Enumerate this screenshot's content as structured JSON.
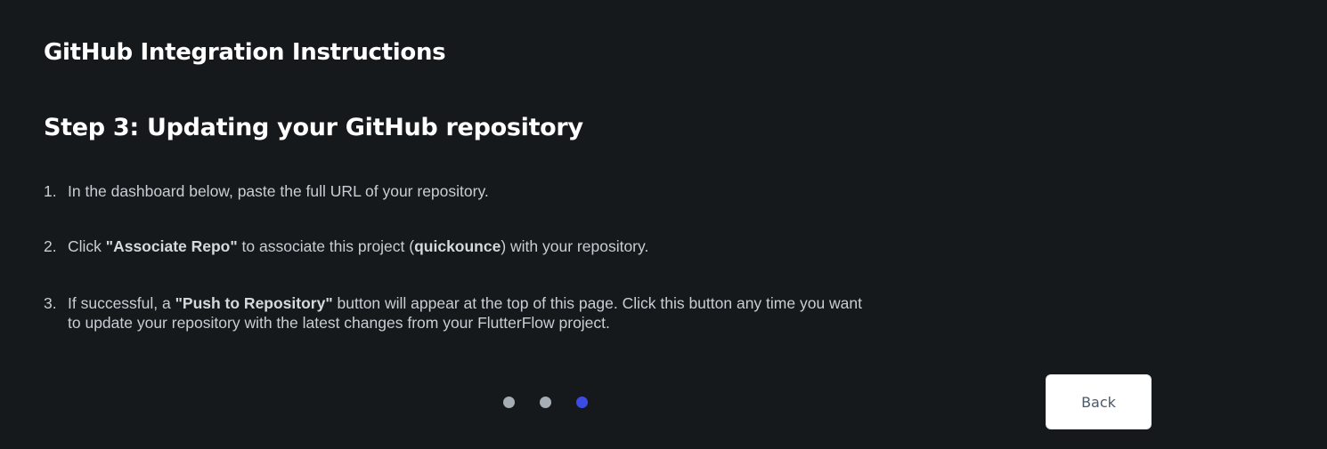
{
  "dialog": {
    "title": "GitHub Integration Instructions",
    "step_title": "Step 3: Updating your GitHub repository",
    "instructions": [
      {
        "number": "1.",
        "text": "In the dashboard below, paste the full URL of your repository."
      },
      {
        "number": "2.",
        "pre": "Click ",
        "bold1": "\"Associate Repo\"",
        "mid": " to associate this project (",
        "bold2": "quickounce",
        "post": ") with your repository."
      },
      {
        "number": "3.",
        "pre": "If successful, a ",
        "bold": "\"Push to Repository\"",
        "post": " button will appear at the top of this page. Click this button any time you want",
        "line2": "to update your repository with the latest changes from your FlutterFlow project."
      }
    ],
    "pagination": {
      "total": 3,
      "current": 3
    },
    "back_label": "Back"
  },
  "colors": {
    "background": "#15191c",
    "heading": "#ffffff",
    "body_text": "#c8ced4",
    "dot_inactive": "#a6adb5",
    "dot_active": "#3d4be6",
    "button_bg": "#ffffff",
    "button_text": "#4a5a6b"
  }
}
